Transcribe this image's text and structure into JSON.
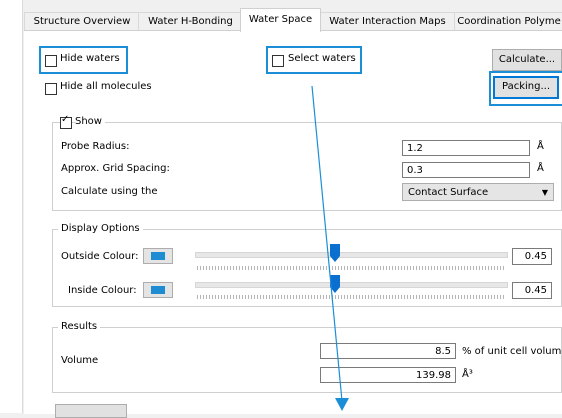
{
  "tabs": [
    {
      "label": "Structure Overview",
      "active": false
    },
    {
      "label": "Water H-Bonding",
      "active": false
    },
    {
      "label": "Water Space",
      "active": true
    },
    {
      "label": "Water Interaction Maps",
      "active": false
    },
    {
      "label": "Coordination Polyme",
      "active": false
    }
  ],
  "controls": {
    "hide_waters": "Hide waters",
    "select_waters": "Select waters",
    "hide_all_molecules": "Hide all molecules",
    "calculate_button": "Calculate...",
    "packing_button": "Packing..."
  },
  "show_group": {
    "title": "Show",
    "checked": true,
    "probe_radius_label": "Probe Radius:",
    "probe_radius_value": "1.2",
    "probe_radius_unit": "Å",
    "grid_spacing_label": "Approx. Grid Spacing:",
    "grid_spacing_value": "0.3",
    "grid_spacing_unit": "Å",
    "calculate_using_label": "Calculate using the",
    "calculate_using_value": "Contact Surface"
  },
  "display_options": {
    "title": "Display Options",
    "outside_label": "Outside Colour:",
    "outside_value": "0.45",
    "outside_level": 0.45,
    "inside_label": "Inside Colour:",
    "inside_value": "0.45",
    "inside_level": 0.45,
    "swatch_color": "#1e8cd2"
  },
  "results": {
    "title": "Results",
    "volume_label": "Volume",
    "percent_value": "8.5",
    "percent_unit": "% of unit cell volume",
    "abs_value": "139.98",
    "abs_unit": "Å³"
  },
  "annotation_color": "#1a8fd8"
}
